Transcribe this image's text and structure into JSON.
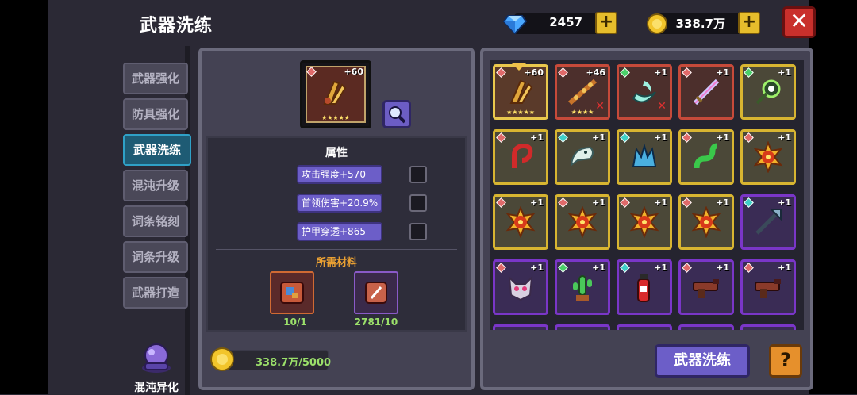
{
  "header": {
    "title": "武器洗练",
    "gems": "2457",
    "gold": "338.7万",
    "plus_label": "+",
    "close_label": "✕"
  },
  "sidebar": {
    "items": [
      {
        "label": "武器强化"
      },
      {
        "label": "防具强化"
      },
      {
        "label": "武器洗练"
      },
      {
        "label": "混沌升级"
      },
      {
        "label": "词条铭刻"
      },
      {
        "label": "词条升级"
      },
      {
        "label": "武器打造"
      }
    ],
    "active_index": 2,
    "chaos_label": "混沌异化"
  },
  "selected_weapon": {
    "level": "+60",
    "stars": "★★★★★"
  },
  "attributes": {
    "title": "属性",
    "items": [
      {
        "label": "攻击强度+570"
      },
      {
        "label": "首领伤害+20.9%"
      },
      {
        "label": "护甲穿透+865"
      }
    ]
  },
  "materials": {
    "title": "所需材料",
    "items": [
      {
        "count": "10/1"
      },
      {
        "count": "2781/10"
      }
    ]
  },
  "cost": {
    "amount": "338.7万/5000"
  },
  "inventory": {
    "rows": [
      [
        {
          "level": "+60",
          "icon": "golden-claw-icon",
          "stars": "★★★★★",
          "gem": "red",
          "frame": "sel"
        },
        {
          "level": "+46",
          "icon": "spiked-chain-icon",
          "stars": "★★★★",
          "gem": "red",
          "frame": "red",
          "locked": "✕"
        },
        {
          "level": "+1",
          "icon": "crescent-blade-icon",
          "gem": "green",
          "frame": "red",
          "locked": "✕"
        },
        {
          "level": "+1",
          "icon": "rainbow-sword-icon",
          "gem": "red",
          "frame": "red"
        },
        {
          "level": "+1",
          "icon": "green-eye-staff-icon",
          "gem": "green",
          "frame": "green"
        }
      ],
      [
        {
          "level": "+1",
          "icon": "red-hook-icon",
          "gem": "red",
          "frame": "green"
        },
        {
          "level": "+1",
          "icon": "bone-jaw-icon",
          "gem": "teal",
          "frame": "green"
        },
        {
          "level": "+1",
          "icon": "ice-crown-icon",
          "gem": "teal",
          "frame": "green"
        },
        {
          "level": "+1",
          "icon": "green-worm-icon",
          "gem": "red",
          "frame": "green"
        },
        {
          "level": "+1",
          "icon": "fire-orb-icon",
          "gem": "red",
          "frame": "green"
        }
      ],
      [
        {
          "level": "+1",
          "icon": "fire-orb-icon",
          "gem": "red",
          "frame": "green"
        },
        {
          "level": "+1",
          "icon": "fire-orb-icon",
          "gem": "red",
          "frame": "green"
        },
        {
          "level": "+1",
          "icon": "fire-orb-icon",
          "gem": "red",
          "frame": "green"
        },
        {
          "level": "+1",
          "icon": "fire-orb-icon",
          "gem": "red",
          "frame": "green"
        },
        {
          "level": "+1",
          "icon": "dark-trident-icon",
          "gem": "teal",
          "frame": "purple"
        }
      ],
      [
        {
          "level": "+1",
          "icon": "cat-mask-icon",
          "gem": "red",
          "frame": "purple"
        },
        {
          "level": "+1",
          "icon": "cactus-icon",
          "gem": "green",
          "frame": "purple"
        },
        {
          "level": "+1",
          "icon": "fire-extinguisher-icon",
          "gem": "teal",
          "frame": "purple"
        },
        {
          "level": "+1",
          "icon": "leather-gun-icon",
          "gem": "red",
          "frame": "purple"
        },
        {
          "level": "+1",
          "icon": "leather-gun-icon",
          "gem": "red",
          "frame": "purple"
        }
      ]
    ]
  },
  "actions": {
    "refine_label": "武器洗练",
    "help_label": "?"
  },
  "colors": {
    "accent_purple": "#6c5ec8",
    "active_tab": "#1e5b74",
    "gold_frame": "#d8b531",
    "purple_frame": "#7a36c8",
    "red_frame": "#c64a3a",
    "close_red": "#c9302c"
  }
}
